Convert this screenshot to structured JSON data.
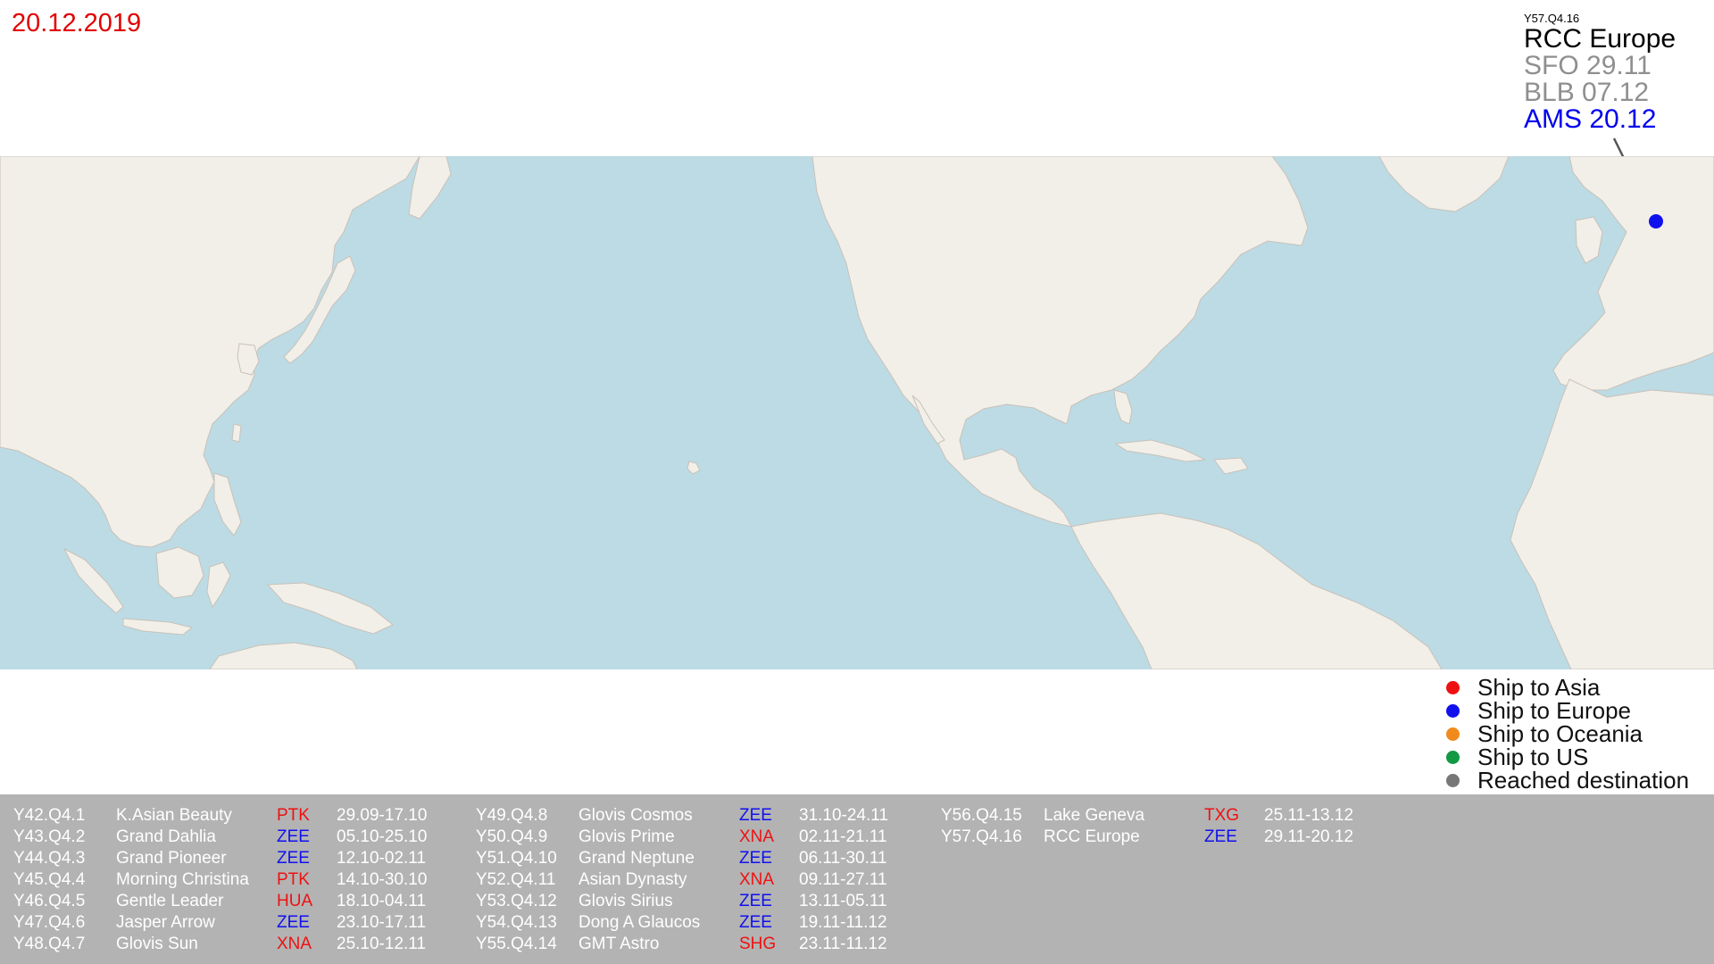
{
  "date": "20.12.2019",
  "ship_info": {
    "code": "Y57.Q4.16",
    "name": "RCC Europe",
    "stops": [
      {
        "label": "SFO 29.11",
        "current": false
      },
      {
        "label": "BLB 07.12",
        "current": false
      },
      {
        "label": "AMS 20.12",
        "current": true
      }
    ]
  },
  "colors": {
    "asia": "#ee1111",
    "europe": "#1111ee",
    "oceania": "#f08a1c",
    "us": "#119944",
    "reached": "#777777",
    "ocean": "#bcdbe4",
    "land": "#f2efe9",
    "panel": "#b3b3b3"
  },
  "legend": [
    {
      "label": "Ship to Asia",
      "color": "#ee1111"
    },
    {
      "label": "Ship to Europe",
      "color": "#1111ee"
    },
    {
      "label": "Ship to Oceania",
      "color": "#f08a1c"
    },
    {
      "label": "Ship to US",
      "color": "#119944"
    },
    {
      "label": "Reached destination",
      "color": "#777777"
    }
  ],
  "ship_marker": {
    "name": "RCC Europe",
    "status": "Ship to Europe",
    "location": "AMS"
  },
  "ships": [
    {
      "code": "Y42.Q4.1",
      "name": "K.Asian Beauty",
      "port": "PTK",
      "port_color": "#ee1111",
      "dates": "29.09-17.10"
    },
    {
      "code": "Y43.Q4.2",
      "name": "Grand Dahlia",
      "port": "ZEE",
      "port_color": "#1111ee",
      "dates": "05.10-25.10"
    },
    {
      "code": "Y44.Q4.3",
      "name": "Grand Pioneer",
      "port": "ZEE",
      "port_color": "#1111ee",
      "dates": "12.10-02.11"
    },
    {
      "code": "Y45.Q4.4",
      "name": "Morning Christina",
      "port": "PTK",
      "port_color": "#ee1111",
      "dates": "14.10-30.10"
    },
    {
      "code": "Y46.Q4.5",
      "name": "Gentle Leader",
      "port": "HUA",
      "port_color": "#ee1111",
      "dates": "18.10-04.11"
    },
    {
      "code": "Y47.Q4.6",
      "name": "Jasper Arrow",
      "port": "ZEE",
      "port_color": "#1111ee",
      "dates": "23.10-17.11"
    },
    {
      "code": "Y48.Q4.7",
      "name": "Glovis Sun",
      "port": "XNA",
      "port_color": "#ee1111",
      "dates": "25.10-12.11"
    },
    {
      "code": "Y49.Q4.8",
      "name": "Glovis Cosmos",
      "port": "ZEE",
      "port_color": "#1111ee",
      "dates": "31.10-24.11"
    },
    {
      "code": "Y50.Q4.9",
      "name": "Glovis Prime",
      "port": "XNA",
      "port_color": "#ee1111",
      "dates": "02.11-21.11"
    },
    {
      "code": "Y51.Q4.10",
      "name": "Grand Neptune",
      "port": "ZEE",
      "port_color": "#1111ee",
      "dates": "06.11-30.11"
    },
    {
      "code": "Y52.Q4.11",
      "name": "Asian Dynasty",
      "port": "XNA",
      "port_color": "#ee1111",
      "dates": "09.11-27.11"
    },
    {
      "code": "Y53.Q4.12",
      "name": "Glovis Sirius",
      "port": "ZEE",
      "port_color": "#1111ee",
      "dates": "13.11-05.11"
    },
    {
      "code": "Y54.Q4.13",
      "name": "Dong A Glaucos",
      "port": "ZEE",
      "port_color": "#1111ee",
      "dates": "19.11-11.12"
    },
    {
      "code": "Y55.Q4.14",
      "name": "GMT Astro",
      "port": "SHG",
      "port_color": "#ee1111",
      "dates": "23.11-11.12"
    },
    {
      "code": "Y56.Q4.15",
      "name": "Lake Geneva",
      "port": "TXG",
      "port_color": "#ee1111",
      "dates": "25.11-13.12"
    },
    {
      "code": "Y57.Q4.16",
      "name": "RCC Europe",
      "port": "ZEE",
      "port_color": "#1111ee",
      "dates": "29.11-20.12"
    }
  ]
}
